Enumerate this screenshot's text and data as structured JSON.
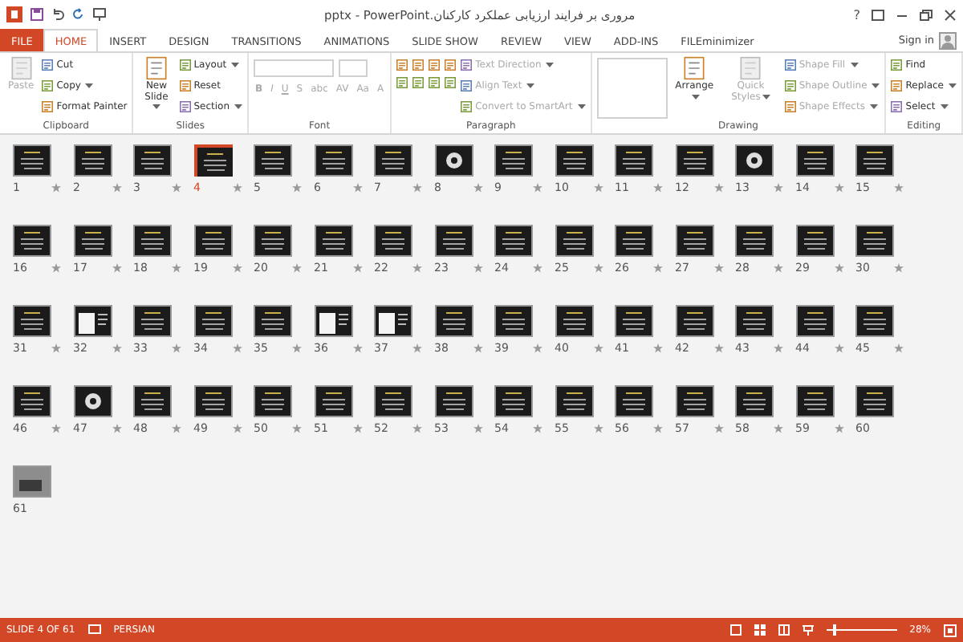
{
  "window": {
    "title": "مروری بر فرایند ارزیابی عملکرد کارکنان.pptx - PowerPoint",
    "help": "?",
    "sign_in": "Sign in"
  },
  "tabs": [
    {
      "label": "FILE",
      "kind": "file",
      "selected": false
    },
    {
      "label": "HOME",
      "kind": "tab",
      "selected": true
    },
    {
      "label": "INSERT",
      "kind": "tab",
      "selected": false
    },
    {
      "label": "DESIGN",
      "kind": "tab",
      "selected": false
    },
    {
      "label": "TRANSITIONS",
      "kind": "tab",
      "selected": false
    },
    {
      "label": "ANIMATIONS",
      "kind": "tab",
      "selected": false
    },
    {
      "label": "SLIDE SHOW",
      "kind": "tab",
      "selected": false
    },
    {
      "label": "REVIEW",
      "kind": "tab",
      "selected": false
    },
    {
      "label": "VIEW",
      "kind": "tab",
      "selected": false
    },
    {
      "label": "ADD-INS",
      "kind": "tab",
      "selected": false
    },
    {
      "label": "FILEminimizer",
      "kind": "tab",
      "selected": false
    }
  ],
  "ribbon": {
    "groups": [
      {
        "label": "Clipboard",
        "kind": "standard",
        "large": [
          {
            "label": "Paste",
            "disabled": true,
            "dropdown": false
          }
        ],
        "small": [
          {
            "label": "Cut",
            "disabled": false,
            "dropdown": false
          },
          {
            "label": "Copy",
            "disabled": false,
            "dropdown": true
          },
          {
            "label": "Format Painter",
            "disabled": false,
            "dropdown": false
          }
        ]
      },
      {
        "label": "Slides",
        "kind": "standard",
        "large": [
          {
            "label": "New Slide",
            "disabled": false,
            "dropdown": true
          }
        ],
        "small": [
          {
            "label": "Layout",
            "disabled": false,
            "dropdown": true
          },
          {
            "label": "Reset",
            "disabled": false,
            "dropdown": false
          },
          {
            "label": "Section",
            "disabled": false,
            "dropdown": true
          }
        ]
      },
      {
        "label": "Font",
        "kind": "font",
        "buttons": [
          {
            "label": "B",
            "disabled": true
          },
          {
            "label": "I",
            "disabled": true
          },
          {
            "label": "U",
            "disabled": true
          },
          {
            "label": "S",
            "disabled": true
          },
          {
            "label": "abc",
            "disabled": true
          },
          {
            "label": "AV",
            "disabled": true
          },
          {
            "label": "Aa",
            "disabled": true
          },
          {
            "label": "A",
            "disabled": true
          }
        ]
      },
      {
        "label": "Paragraph",
        "kind": "paragraph",
        "small": [
          {
            "label": "Text Direction",
            "disabled": true,
            "dropdown": true
          },
          {
            "label": "Align Text",
            "disabled": true,
            "dropdown": true
          },
          {
            "label": "Convert to SmartArt",
            "disabled": true,
            "dropdown": true
          }
        ]
      },
      {
        "label": "Drawing",
        "kind": "drawing",
        "large": [
          {
            "label": "Arrange",
            "disabled": false,
            "dropdown": true
          },
          {
            "label": "Quick Styles",
            "disabled": true,
            "dropdown": true
          }
        ],
        "small": [
          {
            "label": "Shape Fill",
            "disabled": true,
            "dropdown": true
          },
          {
            "label": "Shape Outline",
            "disabled": true,
            "dropdown": true
          },
          {
            "label": "Shape Effects",
            "disabled": true,
            "dropdown": true
          }
        ]
      },
      {
        "label": "Editing",
        "kind": "standard",
        "small": [
          {
            "label": "Find",
            "disabled": false,
            "dropdown": false
          },
          {
            "label": "Replace",
            "disabled": false,
            "dropdown": true
          },
          {
            "label": "Select",
            "disabled": false,
            "dropdown": true
          }
        ]
      }
    ]
  },
  "slides": [
    {
      "number": "1",
      "kind": "text",
      "animated": true,
      "selected": false
    },
    {
      "number": "2",
      "kind": "text",
      "animated": true,
      "selected": false
    },
    {
      "number": "3",
      "kind": "text",
      "animated": true,
      "selected": false
    },
    {
      "number": "4",
      "kind": "text",
      "animated": true,
      "selected": true
    },
    {
      "number": "5",
      "kind": "text",
      "animated": true,
      "selected": false
    },
    {
      "number": "6",
      "kind": "text",
      "animated": true,
      "selected": false
    },
    {
      "number": "7",
      "kind": "text",
      "animated": true,
      "selected": false
    },
    {
      "number": "8",
      "kind": "diagram",
      "animated": true,
      "selected": false
    },
    {
      "number": "9",
      "kind": "text",
      "animated": true,
      "selected": false
    },
    {
      "number": "10",
      "kind": "text",
      "animated": true,
      "selected": false
    },
    {
      "number": "11",
      "kind": "text",
      "animated": true,
      "selected": false
    },
    {
      "number": "12",
      "kind": "text",
      "animated": true,
      "selected": false
    },
    {
      "number": "13",
      "kind": "diagram",
      "animated": true,
      "selected": false
    },
    {
      "number": "14",
      "kind": "text",
      "animated": true,
      "selected": false
    },
    {
      "number": "15",
      "kind": "text",
      "animated": true,
      "selected": false
    },
    {
      "number": "16",
      "kind": "text",
      "animated": true,
      "selected": false
    },
    {
      "number": "17",
      "kind": "text",
      "animated": true,
      "selected": false
    },
    {
      "number": "18",
      "kind": "text",
      "animated": true,
      "selected": false
    },
    {
      "number": "19",
      "kind": "text",
      "animated": true,
      "selected": false
    },
    {
      "number": "20",
      "kind": "text",
      "animated": true,
      "selected": false
    },
    {
      "number": "21",
      "kind": "text",
      "animated": true,
      "selected": false
    },
    {
      "number": "22",
      "kind": "text",
      "animated": true,
      "selected": false
    },
    {
      "number": "23",
      "kind": "text",
      "animated": true,
      "selected": false
    },
    {
      "number": "24",
      "kind": "text",
      "animated": true,
      "selected": false
    },
    {
      "number": "25",
      "kind": "text",
      "animated": true,
      "selected": false
    },
    {
      "number": "26",
      "kind": "text",
      "animated": true,
      "selected": false
    },
    {
      "number": "27",
      "kind": "text",
      "animated": true,
      "selected": false
    },
    {
      "number": "28",
      "kind": "text",
      "animated": true,
      "selected": false
    },
    {
      "number": "29",
      "kind": "text",
      "animated": true,
      "selected": false
    },
    {
      "number": "30",
      "kind": "text",
      "animated": true,
      "selected": false
    },
    {
      "number": "31",
      "kind": "text",
      "animated": true,
      "selected": false
    },
    {
      "number": "32",
      "kind": "document",
      "animated": true,
      "selected": false
    },
    {
      "number": "33",
      "kind": "text",
      "animated": true,
      "selected": false
    },
    {
      "number": "34",
      "kind": "text",
      "animated": true,
      "selected": false
    },
    {
      "number": "35",
      "kind": "text",
      "animated": true,
      "selected": false
    },
    {
      "number": "36",
      "kind": "document",
      "animated": true,
      "selected": false
    },
    {
      "number": "37",
      "kind": "document",
      "animated": true,
      "selected": false
    },
    {
      "number": "38",
      "kind": "text",
      "animated": true,
      "selected": false
    },
    {
      "number": "39",
      "kind": "text",
      "animated": true,
      "selected": false
    },
    {
      "number": "40",
      "kind": "text",
      "animated": true,
      "selected": false
    },
    {
      "number": "41",
      "kind": "text",
      "animated": true,
      "selected": false
    },
    {
      "number": "42",
      "kind": "text",
      "animated": true,
      "selected": false
    },
    {
      "number": "43",
      "kind": "text",
      "animated": true,
      "selected": false
    },
    {
      "number": "44",
      "kind": "text",
      "animated": true,
      "selected": false
    },
    {
      "number": "45",
      "kind": "text",
      "animated": true,
      "selected": false
    },
    {
      "number": "46",
      "kind": "text",
      "animated": true,
      "selected": false
    },
    {
      "number": "47",
      "kind": "diagram",
      "animated": true,
      "selected": false
    },
    {
      "number": "48",
      "kind": "text",
      "animated": true,
      "selected": false
    },
    {
      "number": "49",
      "kind": "text",
      "animated": true,
      "selected": false
    },
    {
      "number": "50",
      "kind": "text",
      "animated": true,
      "selected": false
    },
    {
      "number": "51",
      "kind": "text",
      "animated": true,
      "selected": false
    },
    {
      "number": "52",
      "kind": "text",
      "animated": true,
      "selected": false
    },
    {
      "number": "53",
      "kind": "text",
      "animated": true,
      "selected": false
    },
    {
      "number": "54",
      "kind": "text",
      "animated": true,
      "selected": false
    },
    {
      "number": "55",
      "kind": "text",
      "animated": true,
      "selected": false
    },
    {
      "number": "56",
      "kind": "text",
      "animated": true,
      "selected": false
    },
    {
      "number": "57",
      "kind": "text",
      "animated": true,
      "selected": false
    },
    {
      "number": "58",
      "kind": "text",
      "animated": true,
      "selected": false
    },
    {
      "number": "59",
      "kind": "text",
      "animated": true,
      "selected": false
    },
    {
      "number": "60",
      "kind": "text",
      "animated": false,
      "selected": false
    },
    {
      "number": "61",
      "kind": "photo",
      "animated": false,
      "selected": false
    }
  ],
  "status_bar": {
    "slide_info": "SLIDE 4 OF 61",
    "language": "PERSIAN",
    "zoom": "28%",
    "zoom_slider": {
      "level": 0.1
    }
  }
}
